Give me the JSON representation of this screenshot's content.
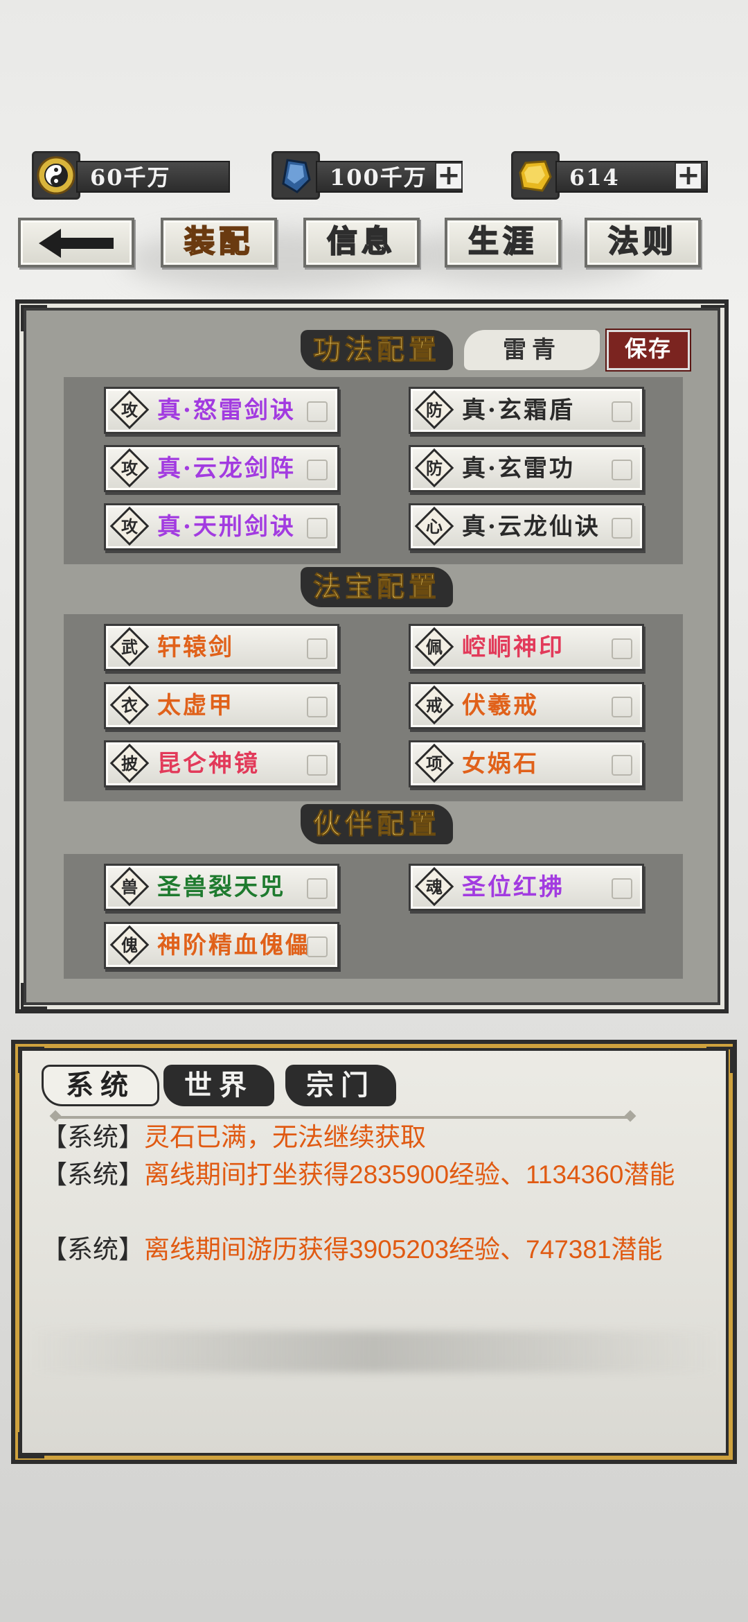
{
  "currency": {
    "yinyang": "60千万",
    "crystal": "100千万",
    "gold": "614",
    "plus": "+"
  },
  "nav": {
    "equip": "装配",
    "info": "信息",
    "career": "生涯",
    "rules": "法则"
  },
  "sections": {
    "skills_title": "功法配置",
    "skill_tag": "雷青",
    "save": "保存",
    "treasure_title": "法宝配置",
    "partner_title": "伙伴配置"
  },
  "skills": [
    {
      "tag": "攻",
      "name": "真·怒雷剑诀",
      "color": "#a23be0"
    },
    {
      "tag": "防",
      "name": "真·玄霜盾",
      "color": "#2a2a2a"
    },
    {
      "tag": "攻",
      "name": "真·云龙剑阵",
      "color": "#a23be0"
    },
    {
      "tag": "防",
      "name": "真·玄雷功",
      "color": "#2a2a2a"
    },
    {
      "tag": "攻",
      "name": "真·天刑剑诀",
      "color": "#a23be0"
    },
    {
      "tag": "心",
      "name": "真·云龙仙诀",
      "color": "#2a2a2a"
    }
  ],
  "treasures": [
    {
      "tag": "武",
      "name": "轩辕剑",
      "color": "#e0611a"
    },
    {
      "tag": "佩",
      "name": "崆峒神印",
      "color": "#e23a5a"
    },
    {
      "tag": "衣",
      "name": "太虚甲",
      "color": "#e0611a"
    },
    {
      "tag": "戒",
      "name": "伏羲戒",
      "color": "#e0611a"
    },
    {
      "tag": "披",
      "name": "昆仑神镜",
      "color": "#e23a5a"
    },
    {
      "tag": "项",
      "name": "女娲石",
      "color": "#e0611a"
    }
  ],
  "partners": [
    {
      "tag": "兽",
      "name": "圣兽裂天兕",
      "color": "#1e7a2e"
    },
    {
      "tag": "魂",
      "name": "圣位红拂",
      "color": "#a23be0"
    },
    {
      "tag": "傀",
      "name": "神阶精血傀儡",
      "color": "#e0611a"
    }
  ],
  "chat": {
    "tabs": [
      "系统",
      "世界",
      "宗门"
    ],
    "messages": [
      {
        "prefix": "【系统】",
        "text": "灵石已满，无法继续获取"
      },
      {
        "prefix": "【系统】",
        "text": "离线期间打坐获得2835900经验、1134360潜能"
      },
      {
        "prefix": "【系统】",
        "text": "离线期间游历获得3905203经验、747381潜能"
      }
    ]
  }
}
